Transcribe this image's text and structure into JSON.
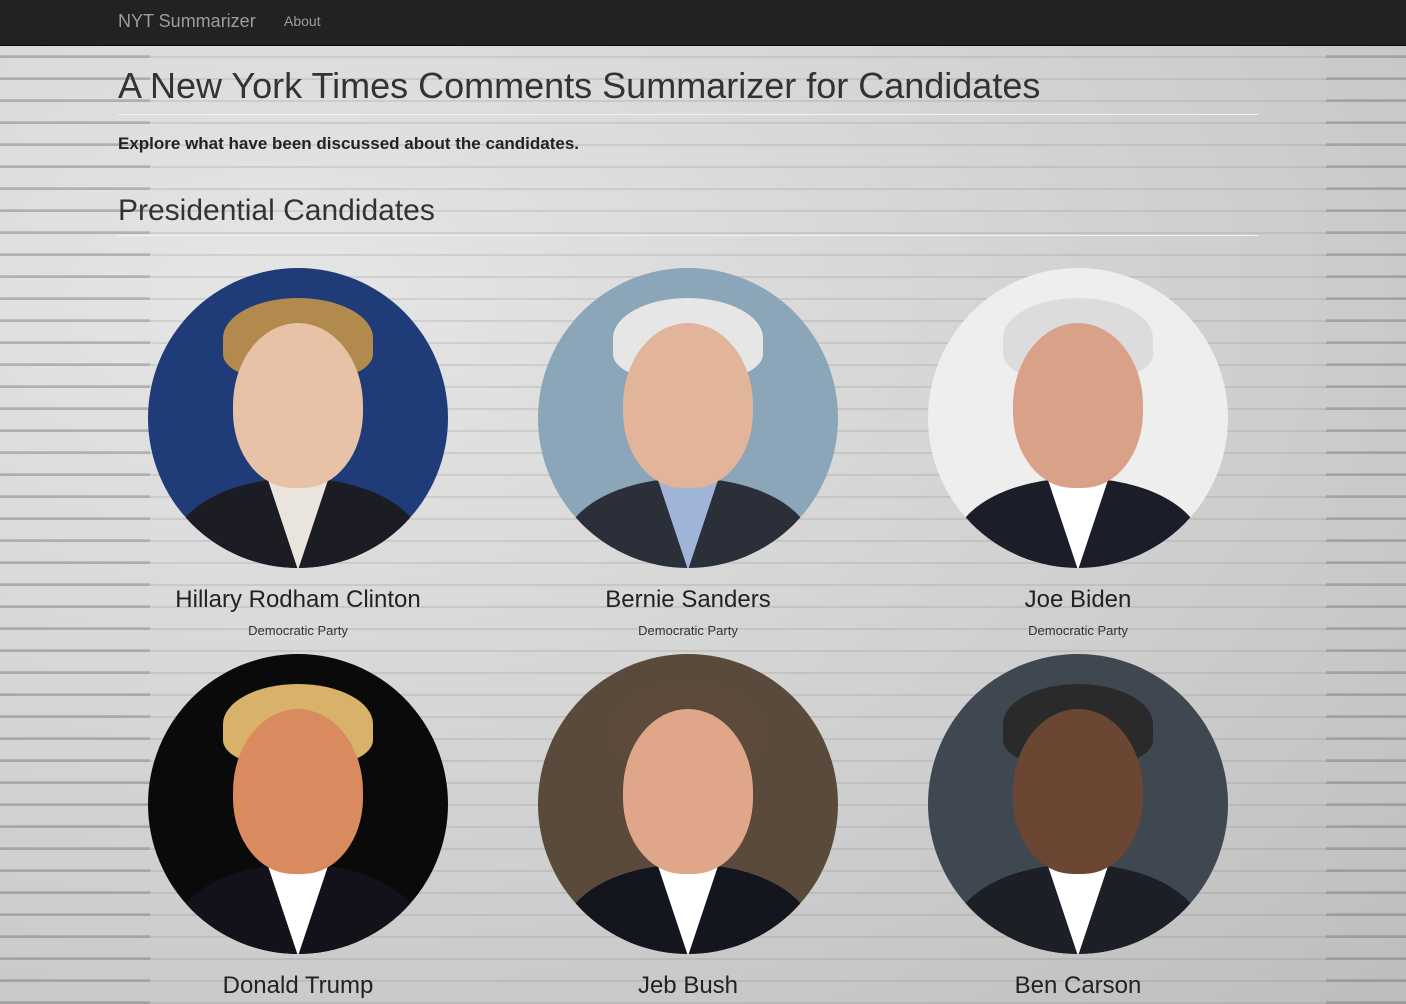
{
  "navbar": {
    "brand": "NYT Summarizer",
    "links": [
      "About"
    ]
  },
  "header": {
    "title": "A New York Times Comments Summarizer for Candidates",
    "subtitle": "Explore what have been discussed about the candidates."
  },
  "section": {
    "title": "Presidential Candidates"
  },
  "candidates": [
    {
      "name": "Hillary Rodham Clinton",
      "party": "Democratic Party",
      "bg": "#1f3c78",
      "skin": "#e8c2a6",
      "hair": "#b38a4e",
      "suit": "#1c1c24",
      "collar": "#e9e4dc"
    },
    {
      "name": "Bernie Sanders",
      "party": "Democratic Party",
      "bg": "#8aa6b8",
      "skin": "#e2b49a",
      "hair": "#e6e6e6",
      "suit": "#2a2f3a",
      "collar": "#9fb4d6"
    },
    {
      "name": "Joe Biden",
      "party": "Democratic Party",
      "bg": "#eeeeee",
      "skin": "#d9a187",
      "hair": "#dcdcdc",
      "suit": "#1b1e28",
      "collar": "#ffffff"
    },
    {
      "name": "Donald Trump",
      "party": "",
      "bg": "#0a0a0a",
      "skin": "#d98a5e",
      "hair": "#d9b26a",
      "suit": "#12121a",
      "collar": "#ffffff"
    },
    {
      "name": "Jeb Bush",
      "party": "",
      "bg": "#5a4a3c",
      "skin": "#e0a68a",
      "hair": "#5c4a3a",
      "suit": "#14161f",
      "collar": "#ffffff"
    },
    {
      "name": "Ben Carson",
      "party": "",
      "bg": "#3f4850",
      "skin": "#6b4633",
      "hair": "#2a2a2a",
      "suit": "#1c2026",
      "collar": "#ffffff"
    }
  ]
}
